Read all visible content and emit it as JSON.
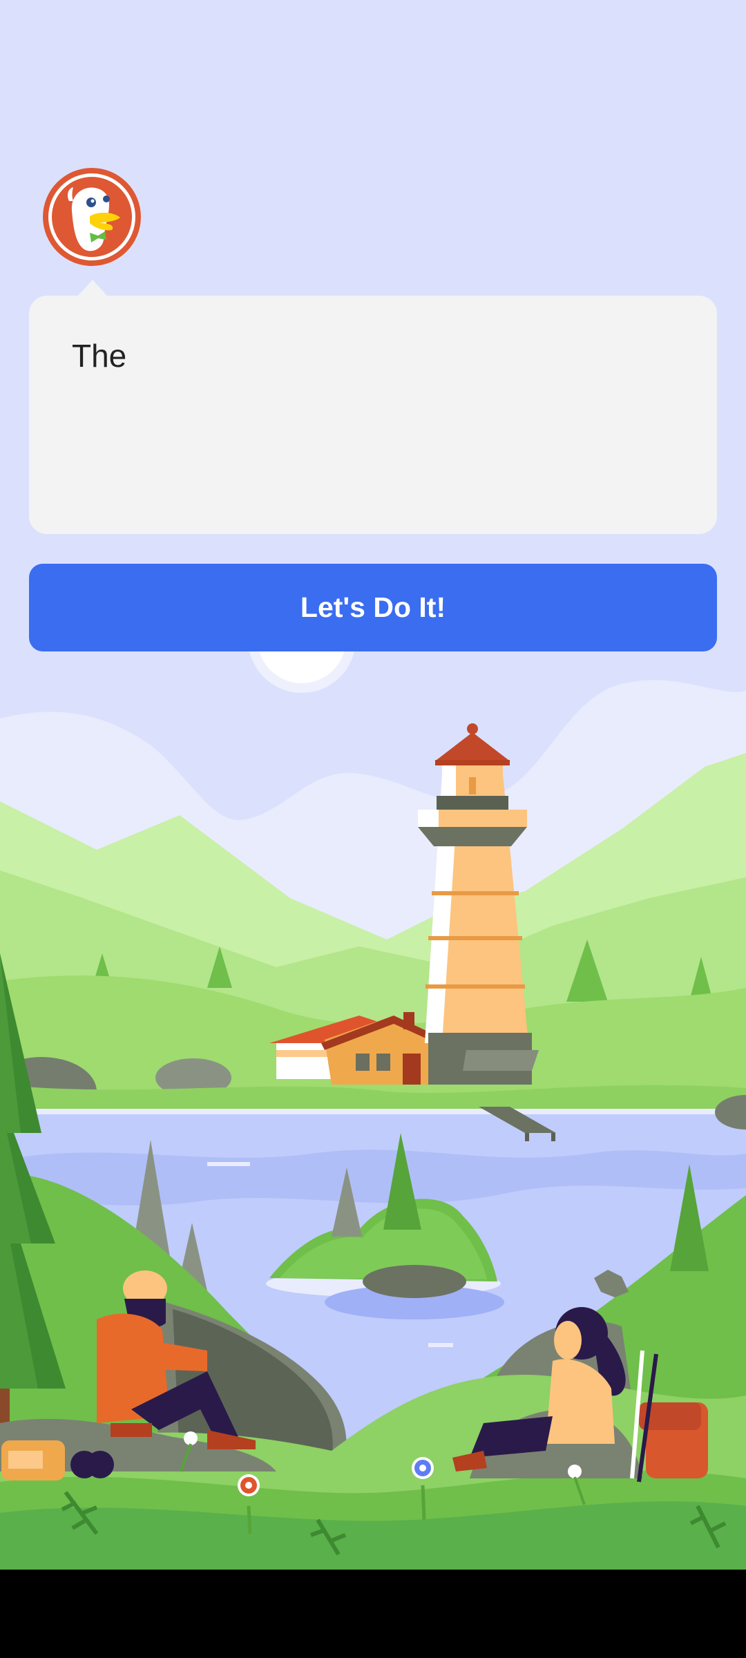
{
  "dialog": {
    "message": "The",
    "primary_button_label": "Let's Do It!"
  },
  "colors": {
    "background": "#dbe1fd",
    "bubble": "#f3f3f3",
    "button": "#3a6df0",
    "button_text": "#ffffff",
    "logo_ring": "#de5833"
  },
  "icons": {
    "logo": "duckduckgo-logo-icon"
  }
}
